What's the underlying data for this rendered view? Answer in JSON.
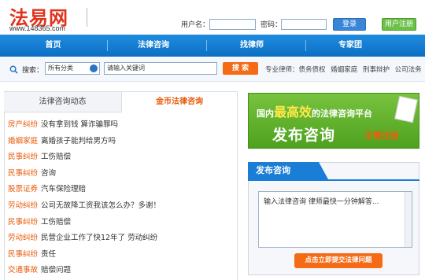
{
  "header": {
    "logo_text": "法易网",
    "logo_url": "www.148365.com",
    "username_label": "用户名：",
    "password_label": "密码：",
    "login_button": "登录",
    "register_button": "用户注册"
  },
  "nav": {
    "items": [
      "首页",
      "法律咨询",
      "找律师",
      "专家团"
    ]
  },
  "search": {
    "label": "搜索：",
    "category_value": "所有分类",
    "input_value": "请输入关键词",
    "button": "搜 索",
    "tags": [
      "专业律师：债务债权",
      "婚姻家庭",
      "刑事辩护",
      "公司法务"
    ]
  },
  "left_panel": {
    "tabs": [
      "法律咨询动态",
      "金币法律咨询"
    ],
    "items": [
      {
        "category": "房产纠纷",
        "title": "没有拿到钱 算诈骗罪吗"
      },
      {
        "category": "婚姻家庭",
        "title": "离婚孩子能判给男方吗"
      },
      {
        "category": "民事纠纷",
        "title": "工伤赔偿"
      },
      {
        "category": "民事纠纷",
        "title": "咨询"
      },
      {
        "category": "股票证券",
        "title": "汽车保险理赔"
      },
      {
        "category": "劳动纠纷",
        "title": "公司无故降工资我该怎么办？多谢！"
      },
      {
        "category": "民事纠纷",
        "title": "工伤赔偿"
      },
      {
        "category": "劳动纠纷",
        "title": "民营企业工作了快12年了 劳动纠纷"
      },
      {
        "category": "民事纠纷",
        "title": "责任"
      },
      {
        "category": "交通事故",
        "title": "赔偿问题"
      }
    ]
  },
  "banner": {
    "line1_pre": "国内",
    "line1_big": "最高效",
    "line1_post": "的法律咨询平台",
    "line2": "发布咨询",
    "line3": "无需注册"
  },
  "consult": {
    "title": "发布咨询",
    "textarea_value": "输入法律咨询 律师最快一分钟解答...",
    "submit_button": "点击立即提交法律问题"
  },
  "colors": {
    "brand_red": "#e0321c",
    "nav_blue": "#1a7dd6",
    "accent_orange": "#f56a14",
    "banner_green": "#5aaa2a"
  }
}
